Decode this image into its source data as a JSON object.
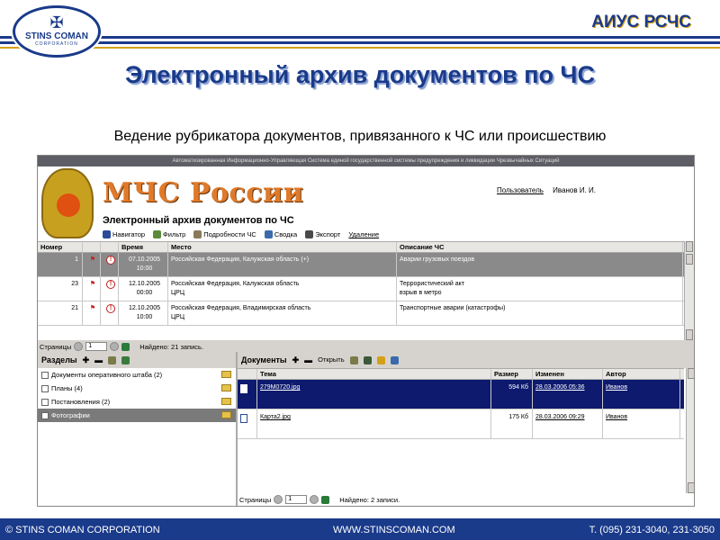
{
  "slide": {
    "logo_name": "STINS COMAN",
    "logo_sub": "CORPORATION",
    "brand": "АИУС РСЧС",
    "title": "Электронный архив документов по ЧС",
    "subtitle": "Ведение рубрикатора документов, привязанного к ЧС или происшествию",
    "footer_left": "© STINS COMAN CORPORATION",
    "footer_mid": "WWW.STINSCOMAN.COM",
    "footer_right": "Т. (095) 231-3040, 231-3050"
  },
  "app": {
    "banner": "Автоматизированная Информационно-Управляющая Система единой государственной системы предупреждения и ликвидации Чрезвычайных Ситуаций",
    "org_title": "МЧС России",
    "user_label": "Пользователь",
    "user_name": "Иванов И. И.",
    "module_title": "Электронный архив документов по ЧС",
    "toolbar": [
      "Навигатор",
      "Фильтр",
      "Подробности ЧС",
      "Сводка",
      "Экспорт",
      "Удаление"
    ],
    "events": {
      "columns": [
        "Номер",
        "",
        "",
        "Время",
        "Место",
        "Описание ЧС"
      ],
      "rows": [
        {
          "num": "1",
          "date": "07.10.2005",
          "time": "10:00",
          "place": "Российская Федерация, Калужская область (+)",
          "place2": "",
          "desc": "Аварии грузовых поездов",
          "desc2": ""
        },
        {
          "num": "23",
          "date": "12.10.2005",
          "time": "00:00",
          "place": "Российская Федерация, Калужская область",
          "place2": "ЦРЦ",
          "desc": "Террористический акт",
          "desc2": "взрыв в метро"
        },
        {
          "num": "21",
          "date": "12.10.2005",
          "time": "10:00",
          "place": "Российская Федерация, Владимирская область",
          "place2": "ЦРЦ",
          "desc": "Транспортные аварии (катастрофы)",
          "desc2": ""
        }
      ],
      "pager_label": "Страницы",
      "page": "1",
      "found": "Найдено: 21 запись."
    },
    "sections": {
      "title": "Разделы",
      "items": [
        {
          "label": "Документы оперативного штаба (2)"
        },
        {
          "label": "Планы (4)"
        },
        {
          "label": "Постановления (2)"
        },
        {
          "label": "Фотографии"
        }
      ]
    },
    "documents": {
      "title": "Документы",
      "open_label": "Открыть",
      "columns": [
        "",
        "Тема",
        "Размер",
        "Изменен",
        "Автор"
      ],
      "rows": [
        {
          "name": "279М0720.jpg",
          "size": "594 Кб",
          "date": "28.03.2006 05:36",
          "author": "Иванов"
        },
        {
          "name": "Карта2.jpg",
          "size": "175 Кб",
          "date": "28.03.2006 09:29",
          "author": "Иванов"
        }
      ],
      "pager_label": "Страницы",
      "page": "1",
      "found": "Найдено: 2 записи."
    }
  },
  "colors": {
    "brand_blue": "#1a3a8a",
    "gold": "#d4a017",
    "mchs_orange": "#e07a2a",
    "selected_doc": "#0d1a6e"
  }
}
